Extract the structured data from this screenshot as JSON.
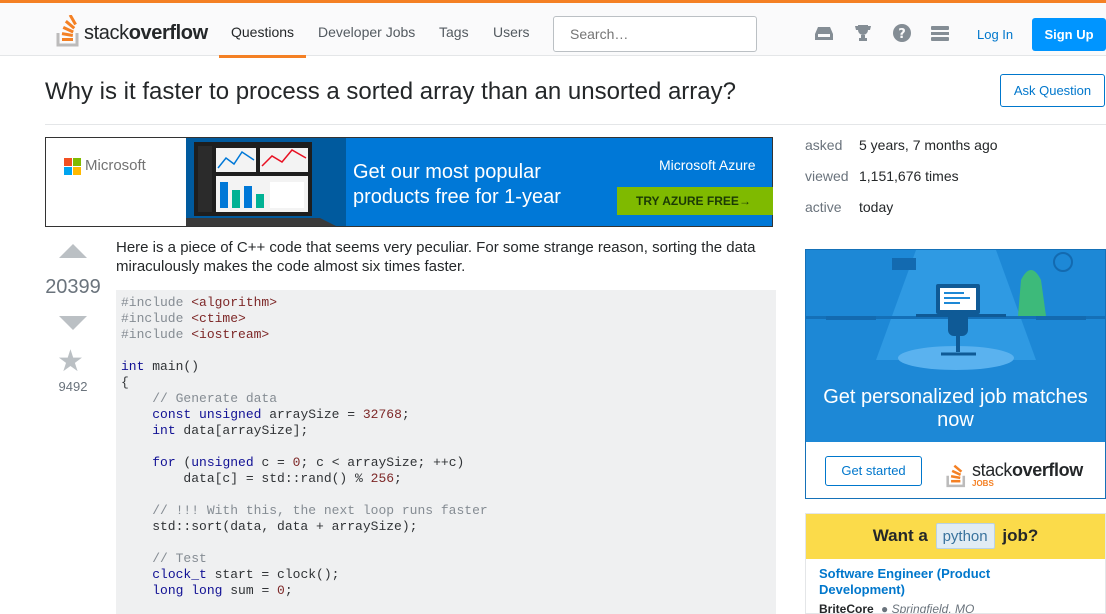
{
  "header": {
    "logo": {
      "prefix": "stack",
      "suffix": "overflow"
    },
    "nav": [
      {
        "label": "Questions",
        "active": true
      },
      {
        "label": "Developer Jobs",
        "active": false
      },
      {
        "label": "Tags",
        "active": false
      },
      {
        "label": "Users",
        "active": false
      }
    ],
    "search_placeholder": "Search…",
    "icons": [
      "inbox-icon",
      "trophy-icon",
      "help-icon",
      "site-switcher-icon"
    ],
    "login_label": "Log In",
    "signup_label": "Sign Up",
    "colors": {
      "accent": "#f48024",
      "link": "#0077cc",
      "primary_button": "#0095ff"
    }
  },
  "question": {
    "title": "Why is it faster to process a sorted array than an unsorted array?",
    "ask_button": "Ask Question",
    "votes": "20399",
    "favorites": "9492",
    "body": "Here is a piece of C++ code that seems very peculiar. For some strange reason, sorting the data miraculously makes the code almost six times faster."
  },
  "ad_banner": {
    "brand": "Microsoft",
    "headline": "Get our most popular products free for 1-year",
    "product": "Microsoft Azure",
    "cta": "TRY AZURE FREE",
    "colors": {
      "background": "#0078d7",
      "cta": "#7fba00"
    }
  },
  "stats": [
    {
      "label": "asked",
      "value": "5 years, 7 months ago"
    },
    {
      "label": "viewed",
      "value": "1,151,676 times"
    },
    {
      "label": "active",
      "value": "today"
    }
  ],
  "jobs_ad": {
    "headline": "Get personalized job matches now",
    "button": "Get started",
    "logo_prefix": "stack",
    "logo_suffix": "overflow",
    "logo_sub": "JOBS"
  },
  "python_ad": {
    "prefix": "Want a",
    "tag": "python",
    "suffix": "job?",
    "job_title": "Software Engineer (Product Development)",
    "company": "BriteCore",
    "location": "Springfield, MO"
  }
}
